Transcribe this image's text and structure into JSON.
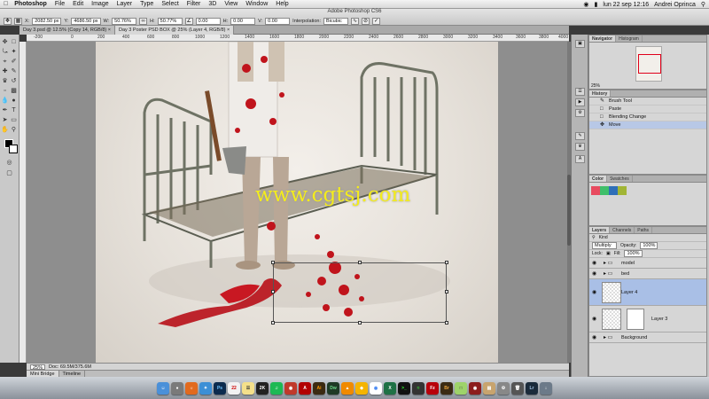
{
  "menubar": {
    "app_name": "Photoshop",
    "items": [
      "File",
      "Edit",
      "Image",
      "Layer",
      "Type",
      "Select",
      "Filter",
      "3D",
      "View",
      "Window",
      "Help"
    ],
    "clock": "lun 22 sep  12:16",
    "user": "Andrei Oprinca"
  },
  "window": {
    "title": "Adobe Photoshop CS6"
  },
  "options_bar": {
    "x_label": "X:",
    "x_value": "2082.50 px",
    "y_label": "Y:",
    "y_value": "4686.50 px",
    "w_label": "W:",
    "w_value": "50.76%",
    "h_label": "H:",
    "h_value": "50.77%",
    "angle_value": "0.00",
    "hskew_label": "H:",
    "hskew_value": "0.00",
    "vskew_label": "V:",
    "vskew_value": "0.00",
    "interpolation_label": "Interpolation:",
    "interpolation_value": "Bicubic"
  },
  "doc_tabs": [
    {
      "label": "Day 3.psd @ 12.5% (Copy 14, RGB/8)",
      "active": false
    },
    {
      "label": "Day 3 Poster PSD BOX @ 25% (Layer 4, RGB/8)",
      "active": true
    }
  ],
  "ruler_h": [
    "-200",
    "0",
    "200",
    "400",
    "600",
    "800",
    "1000",
    "1200",
    "1400",
    "1600",
    "1800",
    "2000",
    "2200",
    "2400",
    "2600",
    "2800",
    "3000",
    "3200",
    "3400",
    "3600",
    "3800",
    "4000"
  ],
  "canvas": {
    "watermark": "www.cgtsj.com"
  },
  "status": {
    "zoom": "25%",
    "doc_info": "Doc: 69.5M/375.6M"
  },
  "bottom_tabs": [
    "Mini Bridge",
    "Timeline"
  ],
  "navigator": {
    "tabs": [
      "Navigator",
      "Histogram"
    ],
    "zoom": "25%"
  },
  "history": {
    "tab": "History",
    "items": [
      "Brush Tool",
      "Paste",
      "Blending Change",
      "Move"
    ]
  },
  "color_panel": {
    "tabs": [
      "Color",
      "Swatches"
    ],
    "swatches": [
      "#e84a5f",
      "#3fbf6a",
      "#2f6fb8",
      "#a1b535"
    ]
  },
  "layers": {
    "tabs": [
      "Layers",
      "Channels",
      "Paths"
    ],
    "kind_label": "Kind",
    "blend_mode": "Multiply",
    "opacity_label": "Opacity:",
    "opacity_value": "100%",
    "fill_label": "Fill:",
    "fill_value": "100%",
    "lock_label": "Lock:",
    "items": [
      {
        "name": "model",
        "type": "group"
      },
      {
        "name": "bed",
        "type": "group"
      },
      {
        "name": "Layer 4",
        "type": "layer",
        "active": true
      },
      {
        "name": "Layer 3",
        "type": "layer-mask"
      },
      {
        "name": "Background",
        "type": "group"
      }
    ]
  },
  "dock": {
    "apps": [
      "Finder",
      "Launchpad",
      "Firefox",
      "Safari",
      "Photoshop",
      "Calendar",
      "Notes",
      "2K",
      "Spotify",
      "Capture",
      "Acrobat",
      "Ai",
      "Dw",
      "VLC",
      "Sketch",
      "Chrome",
      "Excel",
      "Terminal",
      "Activity",
      "FileZilla",
      "Bridge",
      "Stickies",
      "Photo Booth",
      "Books",
      "Preferences",
      "Trash",
      "Lr",
      "Downloads"
    ]
  }
}
